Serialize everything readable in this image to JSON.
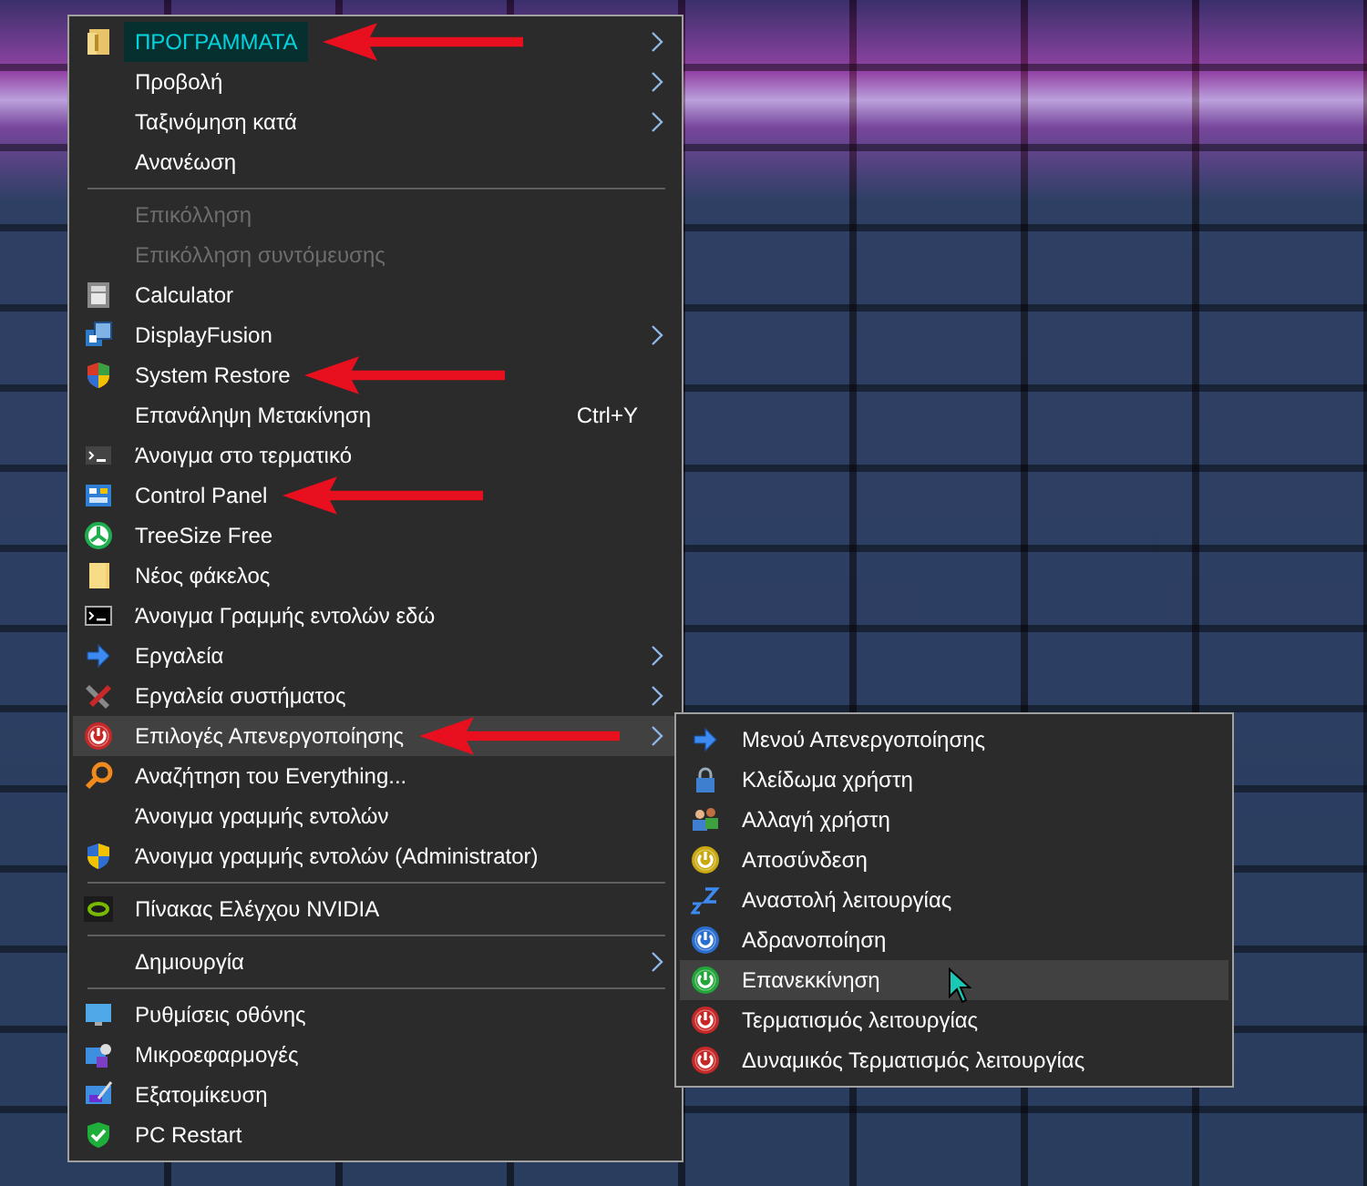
{
  "context_menu": {
    "items": [
      {
        "kind": "item",
        "label": "ΠΡΟΓΡΑΜΜΑΤΑ",
        "submenu": true,
        "highlighted": true,
        "marked": true
      },
      {
        "kind": "item",
        "label": "Προβολή",
        "submenu": true
      },
      {
        "kind": "item",
        "label": "Ταξινόμηση κατά",
        "submenu": true
      },
      {
        "kind": "item",
        "label": "Ανανέωση"
      },
      {
        "kind": "separator"
      },
      {
        "kind": "item",
        "label": "Επικόλληση",
        "disabled": true
      },
      {
        "kind": "item",
        "label": "Επικόλληση συντόμευσης",
        "disabled": true
      },
      {
        "kind": "item",
        "label": "Calculator"
      },
      {
        "kind": "item",
        "label": "DisplayFusion",
        "submenu": true
      },
      {
        "kind": "item",
        "label": "System Restore",
        "marked": true
      },
      {
        "kind": "item",
        "label": "Επανάληψη Μετακίνηση",
        "shortcut": "Ctrl+Y"
      },
      {
        "kind": "item",
        "label": "Άνοιγμα στο τερματικό"
      },
      {
        "kind": "item",
        "label": "Control Panel",
        "marked": true
      },
      {
        "kind": "item",
        "label": "TreeSize Free"
      },
      {
        "kind": "item",
        "label": "Νέος φάκελος"
      },
      {
        "kind": "item",
        "label": "Άνοιγμα Γραμμής εντολών εδώ"
      },
      {
        "kind": "item",
        "label": "Εργαλεία",
        "submenu": true
      },
      {
        "kind": "item",
        "label": "Εργαλεία συστήματος",
        "submenu": true
      },
      {
        "kind": "item",
        "label": "Επιλογές Απενεργοποίησης",
        "submenu": true,
        "selected": true,
        "marked": true
      },
      {
        "kind": "item",
        "label": "Αναζήτηση του Everything..."
      },
      {
        "kind": "item",
        "label": "Άνοιγμα γραμμής εντολών"
      },
      {
        "kind": "item",
        "label": "Άνοιγμα γραμμής εντολών (Administrator)"
      },
      {
        "kind": "separator"
      },
      {
        "kind": "item",
        "label": "Πίνακας Ελέγχου NVIDIA"
      },
      {
        "kind": "separator"
      },
      {
        "kind": "item",
        "label": "Δημιουργία",
        "submenu": true
      },
      {
        "kind": "separator"
      },
      {
        "kind": "item",
        "label": "Ρυθμίσεις οθόνης"
      },
      {
        "kind": "item",
        "label": "Μικροεφαρμογές"
      },
      {
        "kind": "item",
        "label": "Εξατομίκευση"
      },
      {
        "kind": "item",
        "label": "PC Restart"
      }
    ]
  },
  "submenu": {
    "items": [
      {
        "label": "Μενού Απενεργοποίησης",
        "selected": false
      },
      {
        "label": "Κλείδωμα χρήστη",
        "selected": false
      },
      {
        "label": "Αλλαγή χρήστη",
        "selected": false
      },
      {
        "label": "Αποσύνδεση",
        "selected": false
      },
      {
        "label": "Αναστολή λειτουργίας",
        "selected": false
      },
      {
        "label": "Αδρανοποίηση",
        "selected": false
      },
      {
        "label": "Επανεκκίνηση",
        "selected": true
      },
      {
        "label": "Τερματισμός λειτουργίας",
        "selected": false
      },
      {
        "label": "Δυναμικός Τερματισμός λειτουργίας",
        "selected": false
      }
    ]
  }
}
